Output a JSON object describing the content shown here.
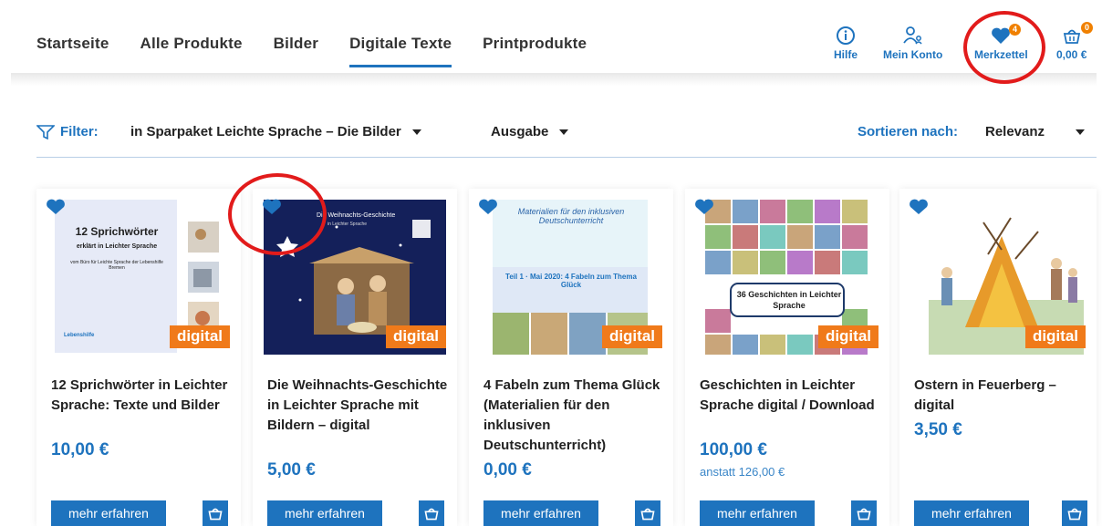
{
  "nav": {
    "items": [
      "Startseite",
      "Alle Produkte",
      "Bilder",
      "Digitale Texte",
      "Printprodukte"
    ],
    "active": "Digitale Texte"
  },
  "header": {
    "help_label": "Hilfe",
    "account_label": "Mein Konto",
    "wishlist_label": "Merkzettel",
    "wishlist_count": "4",
    "cart_total": "0,00 €",
    "cart_count": "0"
  },
  "filter": {
    "label": "Filter:",
    "selected": "in Sparpaket Leichte Sprache – Die Bilder",
    "edition": "Ausgabe",
    "sort_label": "Sortieren nach:",
    "sort_value": "Relevanz"
  },
  "products": [
    {
      "title": "12 Sprichwörter in Leichter Sprache: Texte und Bilder",
      "price": "10,00 €",
      "old_price": "",
      "badge": "digital",
      "cover_title": "12 Sprichwörter",
      "cover_sub": "erklärt in Leichter Sprache",
      "cover_small": "vom Büro für Leichte Sprache der Lebenshilfe Bremen",
      "cover_logo": "Lebenshilfe"
    },
    {
      "title": "Die Weihnachts-Geschichte in Leichter Sprache mit Bildern – digital",
      "price": "5,00 €",
      "old_price": "",
      "badge": "digital",
      "cover_title": "Die Weihnachts-Geschichte",
      "cover_sub": "in Leichter Sprache"
    },
    {
      "title": "4 Fabeln zum Thema Glück (Materialien für den inklusiven Deutschunterricht)",
      "price": "0,00 €",
      "old_price": "",
      "badge": "digital",
      "cover_title": "Materialien für den inklusiven Deutschunterricht",
      "cover_sub": "Teil 1 · Mai 2020: 4 Fabeln zum Thema Glück"
    },
    {
      "title": "Geschichten in Leichter Sprache digital / Download",
      "price": "100,00 €",
      "old_price": "anstatt 126,00 €",
      "badge": "digital",
      "cover_title": "36 Geschichten in Leichter Sprache"
    },
    {
      "title": "Ostern in Feuerberg – digital",
      "price": "3,50 €",
      "old_price": "",
      "badge": "digital"
    }
  ],
  "buttons": {
    "more_label": "mehr erfahren"
  },
  "colors": {
    "accent": "#1e73be",
    "badge": "#f07a1a",
    "highlight": "#e21b1b"
  }
}
